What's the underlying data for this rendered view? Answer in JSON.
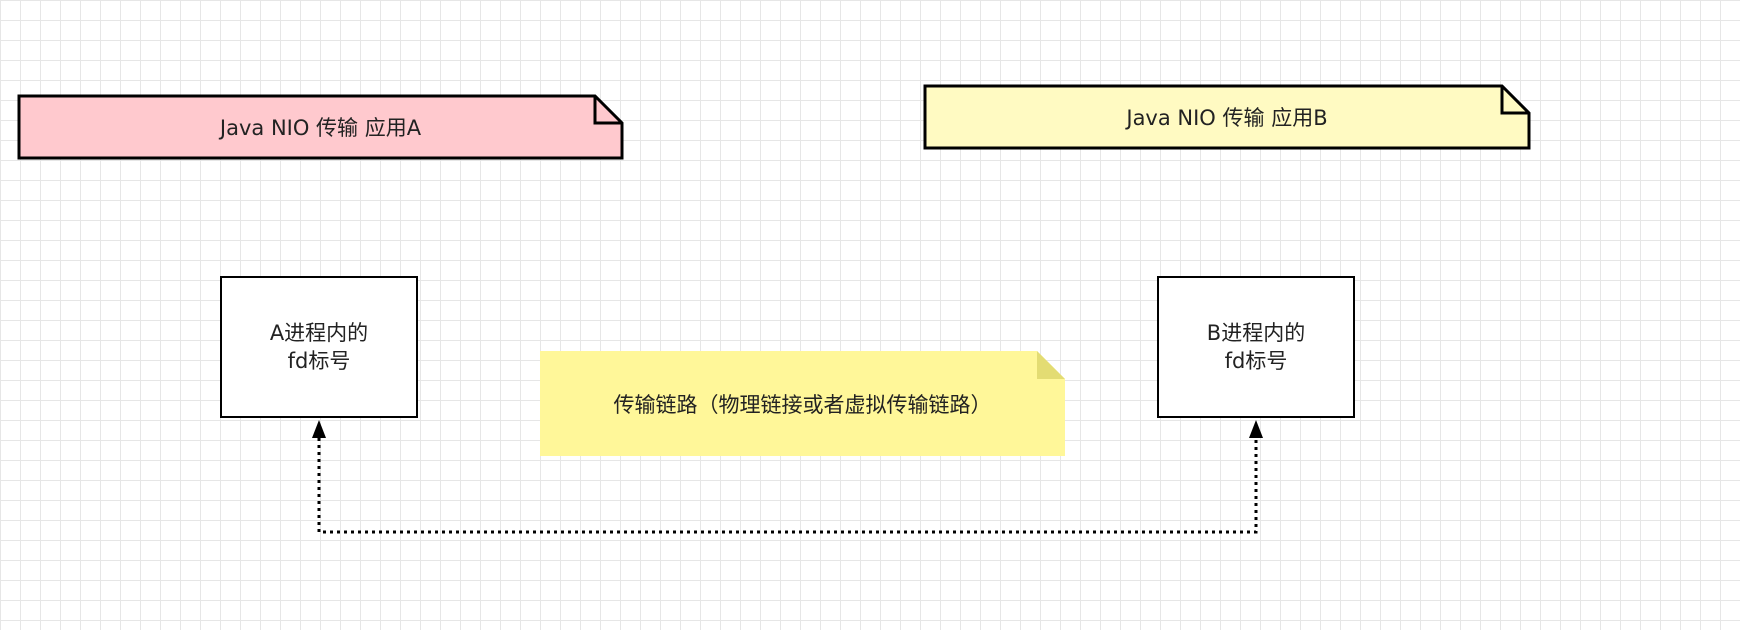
{
  "notes": {
    "app_a": {
      "label": "Java NIO 传输 应用A",
      "fill": "#ffc9ce",
      "stroke": "#000000"
    },
    "app_b": {
      "label": "Java NIO 传输 应用B",
      "fill": "#fffac2",
      "stroke": "#000000"
    },
    "link": {
      "label": "传输链路（物理链接或者虚拟传输链路）",
      "fill": "#fff799",
      "fold": "#e3dc73"
    }
  },
  "boxes": {
    "fd_a": {
      "line1": "A进程内的",
      "line2": "fd标号"
    },
    "fd_b": {
      "line1": "B进程内的",
      "line2": "fd标号"
    }
  },
  "connector": {
    "style": "dotted",
    "color": "#000000",
    "arrowheads": "both-ends-up"
  }
}
